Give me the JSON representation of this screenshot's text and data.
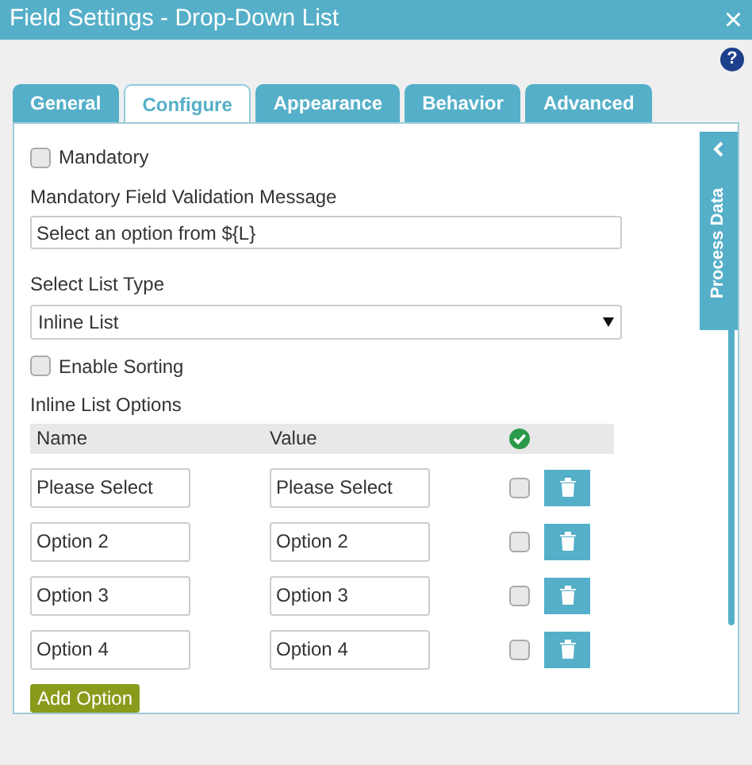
{
  "window": {
    "title": "Field Settings - Drop-Down List",
    "close": "×"
  },
  "help": "?",
  "tabs": [
    {
      "label": "General",
      "selected": false
    },
    {
      "label": "Configure",
      "selected": true
    },
    {
      "label": "Appearance",
      "selected": false
    },
    {
      "label": "Behavior",
      "selected": false
    },
    {
      "label": "Advanced",
      "selected": false
    }
  ],
  "mandatory": {
    "label": "Mandatory",
    "checked": false
  },
  "validation": {
    "label": "Mandatory Field Validation Message",
    "value": "Select an option from ${L}"
  },
  "list_type": {
    "label": "Select List Type",
    "value": "Inline List"
  },
  "sorting": {
    "label": "Enable Sorting",
    "checked": false
  },
  "options": {
    "label": "Inline List Options",
    "columns": [
      "Name",
      "Value"
    ],
    "rows": [
      {
        "name": "Please Select",
        "value": "Please Select",
        "checked": false
      },
      {
        "name": "Option 2",
        "value": "Option 2",
        "checked": false
      },
      {
        "name": "Option 3",
        "value": "Option 3",
        "checked": false
      },
      {
        "name": "Option 4",
        "value": "Option 4",
        "checked": false
      }
    ]
  },
  "add_button": "Add Option",
  "side_panel": {
    "label": "Process Data"
  }
}
